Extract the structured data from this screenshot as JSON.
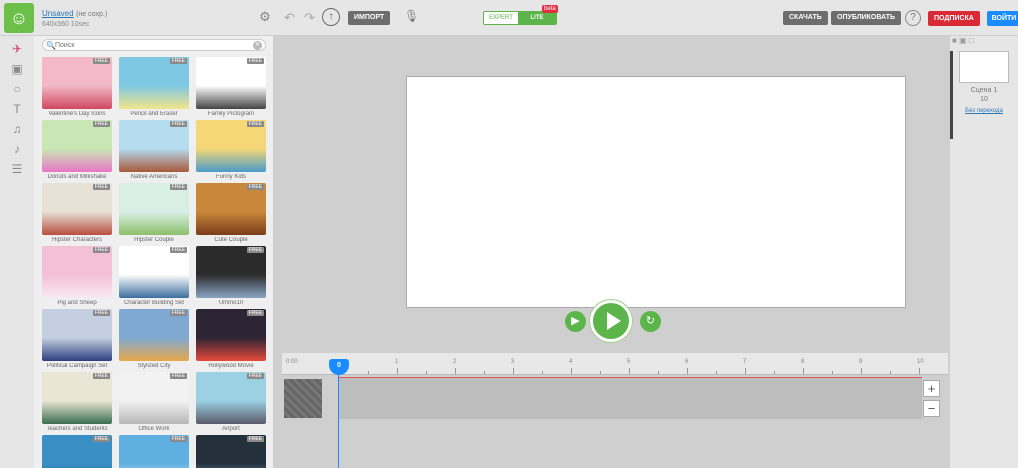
{
  "header": {
    "project_name": "Unsaved",
    "project_status": "(не сохр.)",
    "dimensions": "640x360 10sec",
    "import_label": "ИМПОРТ",
    "mode_expert": "EXPERT",
    "mode_lite": "LITE",
    "beta_badge": "beta",
    "download_label": "СКАЧАТЬ",
    "publish_label": "ОПУБЛИКОВАТЬ",
    "help_label": "?",
    "subscribe_label": "ПОДПИСКА",
    "login_label": "ВОЙТИ"
  },
  "rail_icons": [
    "rocket-icon",
    "image-icon",
    "speech-bubble-icon",
    "text-icon",
    "music-icon",
    "sound-icon",
    "layers-icon"
  ],
  "library": {
    "search_placeholder": "Поиск",
    "free_badge": "FREE",
    "items": [
      {
        "name": "Valentine's Day Icons",
        "colors": [
          "#f3b9c8",
          "#d04860"
        ]
      },
      {
        "name": "Pencil and Eraser",
        "colors": [
          "#7ec8e3",
          "#f3e58a"
        ]
      },
      {
        "name": "Family Pictogram",
        "colors": [
          "#ffffff",
          "#444444"
        ]
      },
      {
        "name": "Donuts and Milkshake",
        "colors": [
          "#c9e7b4",
          "#e877c6"
        ]
      },
      {
        "name": "Native Americans",
        "colors": [
          "#b5dcef",
          "#a85a3a"
        ]
      },
      {
        "name": "Funny Kids",
        "colors": [
          "#f5d777",
          "#4a9cc9"
        ]
      },
      {
        "name": "Hipster Characters",
        "colors": [
          "#e8e2d6",
          "#b74e40"
        ]
      },
      {
        "name": "Hipster Couple",
        "colors": [
          "#d9efe6",
          "#8cc06a"
        ]
      },
      {
        "name": "Cute Couple",
        "colors": [
          "#c8873a",
          "#7a3d1b"
        ]
      },
      {
        "name": "Pig and Sheep",
        "colors": [
          "#f4c0d8",
          "#f7e8f0"
        ]
      },
      {
        "name": "Character Building Set",
        "colors": [
          "#ffffff",
          "#3b6e9e"
        ]
      },
      {
        "name": "Ummo10",
        "colors": [
          "#2b2b2b",
          "#8aa4c4"
        ]
      },
      {
        "name": "Political Campaign Set",
        "colors": [
          "#c4d0e2",
          "#2c3e80"
        ]
      },
      {
        "name": "Stylized City",
        "colors": [
          "#7fa8d3",
          "#e7a84b"
        ]
      },
      {
        "name": "Hollywood Movie",
        "colors": [
          "#2d2435",
          "#e64b3b"
        ]
      },
      {
        "name": "Teachers and Students",
        "colors": [
          "#e9e6d5",
          "#3a6e4e"
        ]
      },
      {
        "name": "Office Work",
        "colors": [
          "#f2f2f2",
          "#b7b7b7"
        ]
      },
      {
        "name": "Airport",
        "colors": [
          "#9cd1e4",
          "#5a5a6a"
        ]
      },
      {
        "name": "",
        "colors": [
          "#3a8fc4",
          "#1f5c84"
        ]
      },
      {
        "name": "",
        "colors": [
          "#5fb0e0",
          "#f0f0f0"
        ]
      },
      {
        "name": "",
        "colors": [
          "#25303d",
          "#8cc6d8"
        ]
      }
    ]
  },
  "timeline": {
    "start_label": "0:00",
    "marker_label": "0",
    "ticks": [
      "1",
      "2",
      "3",
      "4",
      "5",
      "6",
      "7",
      "8",
      "9",
      "10"
    ],
    "zoom_in": "+",
    "zoom_out": "−"
  },
  "scenes": {
    "scene_name": "Сцена 1",
    "scene_length": "10",
    "transition_link": "Без перехода"
  }
}
